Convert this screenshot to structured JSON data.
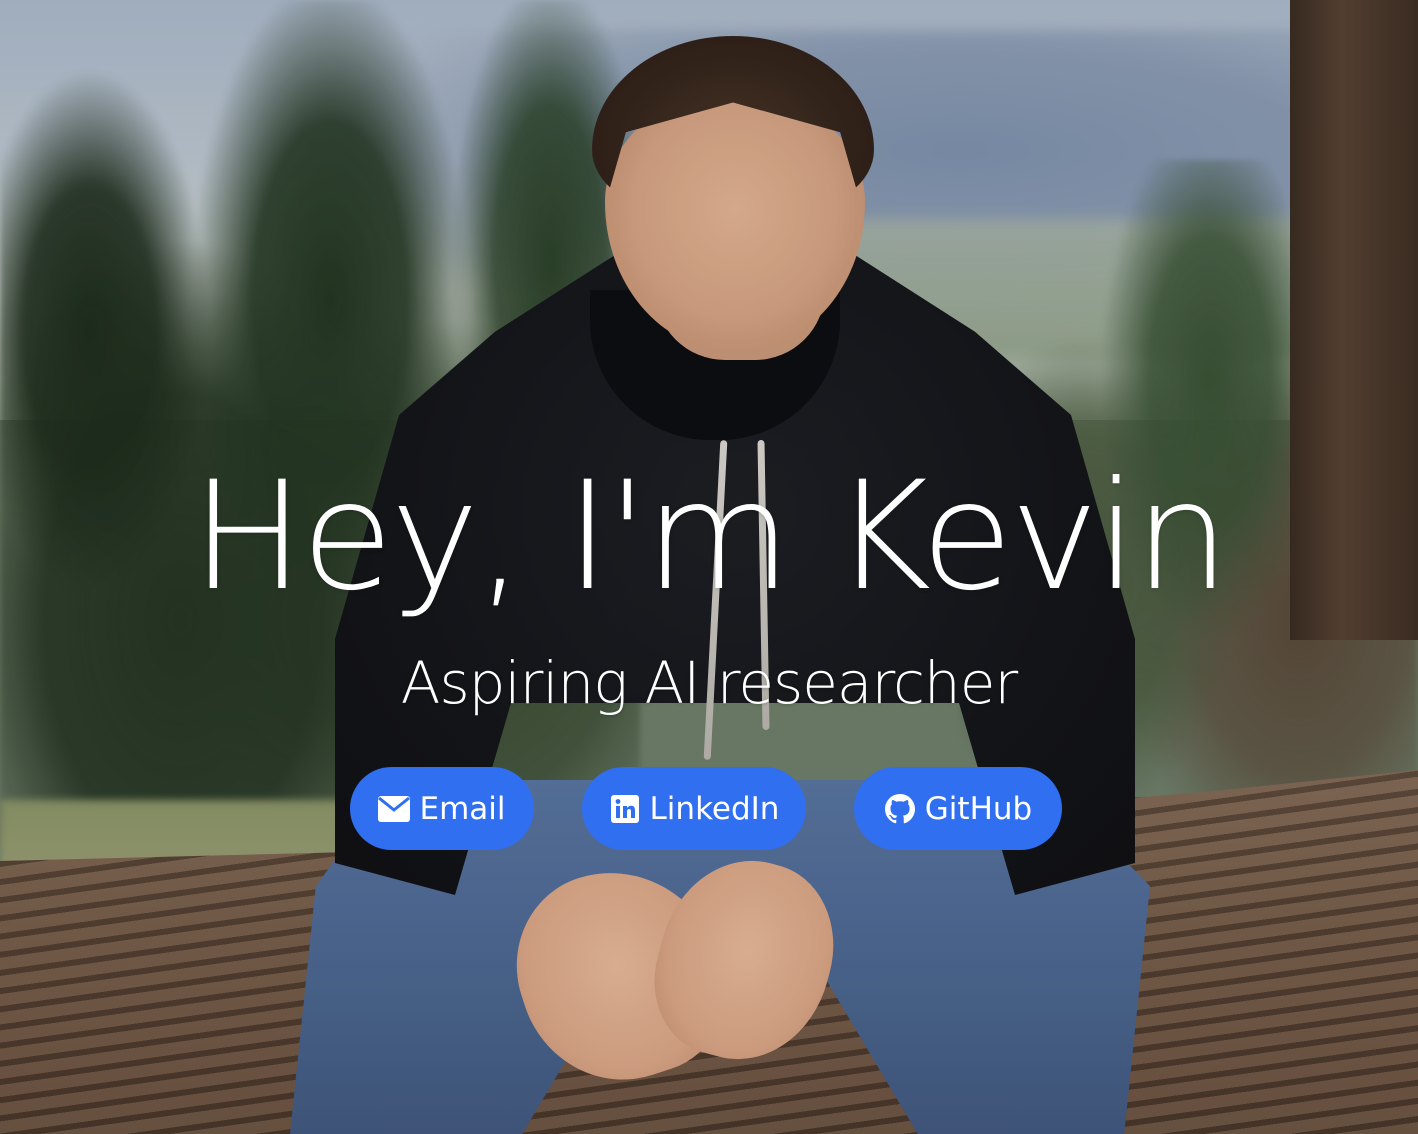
{
  "hero": {
    "title": "Hey, I'm Kevin",
    "subtitle": "Aspiring AI researcher"
  },
  "links": [
    {
      "label": "Email",
      "icon": "envelope-icon"
    },
    {
      "label": "LinkedIn",
      "icon": "linkedin-icon"
    },
    {
      "label": "GitHub",
      "icon": "github-icon"
    }
  ],
  "colors": {
    "button_bg": "#2f6ff0",
    "button_text": "#ffffff",
    "heading_text": "#ffffff"
  }
}
